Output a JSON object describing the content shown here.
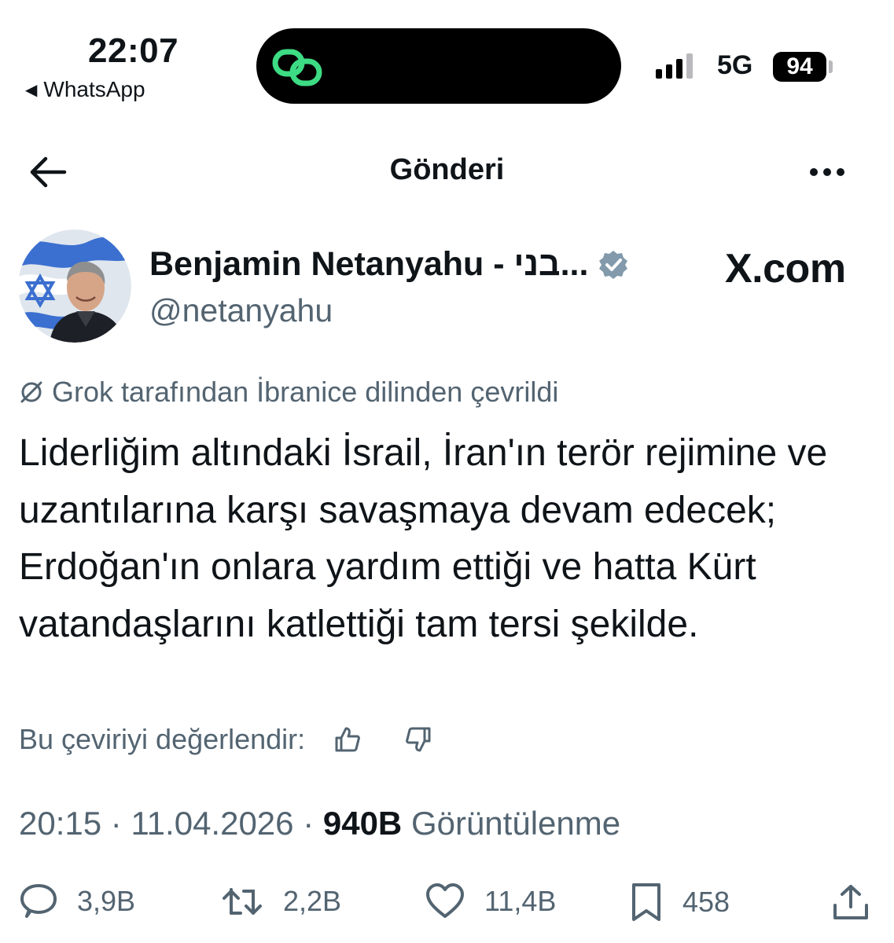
{
  "status_bar": {
    "time": "22:07",
    "back_app": "WhatsApp",
    "network": "5G",
    "battery": "94"
  },
  "header": {
    "title": "Gönderi"
  },
  "author": {
    "name": "Benjamin Netanyahu - בני...",
    "handle": "@netanyahu",
    "verified": true
  },
  "watermark": "X.com",
  "translation_note": "Grok tarafından İbranice dilinden çevrildi",
  "tweet_text": "Liderliğim altındaki İsrail, İran'ın terör rejimine ve uzantılarına karşı savaşmaya devam edecek; Erdoğan'ın onlara yardım ettiği ve hatta Kürt vatandaşlarını katlettiği tam tersi şekilde.",
  "rate_translation": "Bu çeviriyi değerlendir:",
  "meta": {
    "time": "20:15",
    "date": "11.04.2026",
    "views_count": "940B",
    "views_label": "Görüntülenme"
  },
  "actions": {
    "replies": "3,9B",
    "reposts": "2,2B",
    "likes": "11,4B",
    "bookmarks": "458"
  },
  "colors": {
    "text": "#0f1419",
    "secondary": "#536471",
    "verified": "#829aab",
    "island_icon": "#3ddc84"
  }
}
